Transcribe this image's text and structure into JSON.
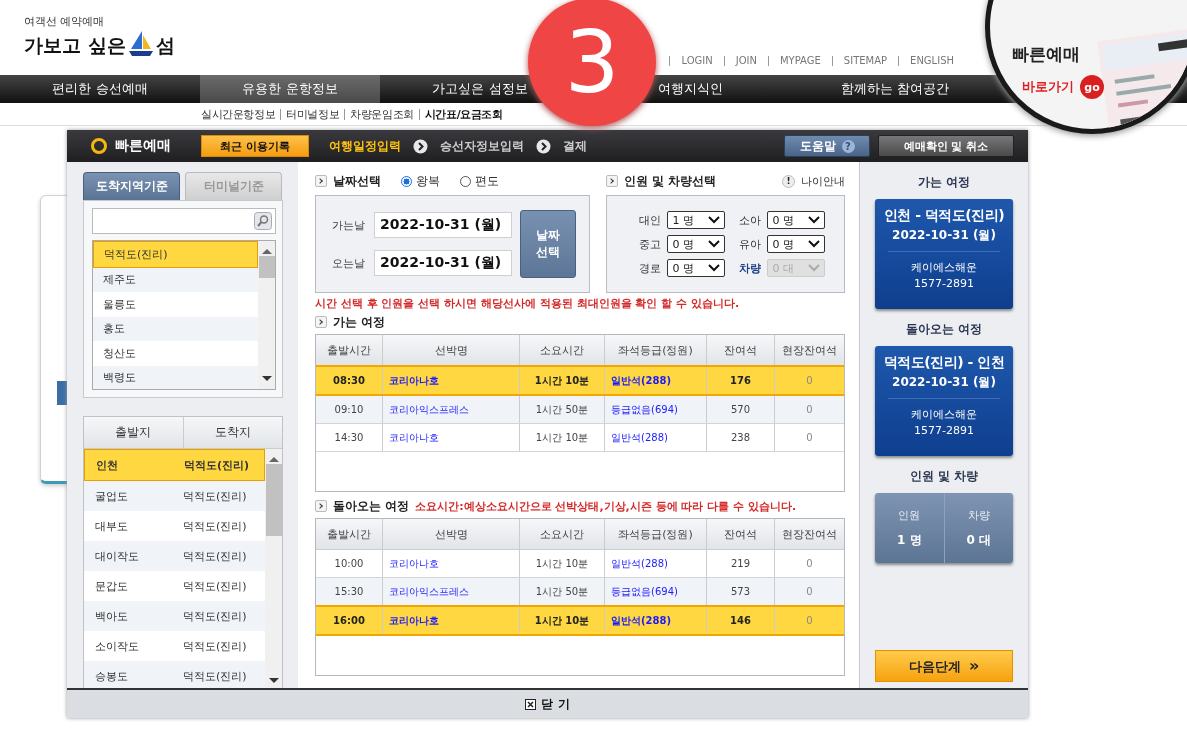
{
  "header": {
    "logo_tagline": "여객선 예약예매",
    "logo_left": "가보고 싶은",
    "logo_right": "섬",
    "top_links": [
      "LOGIN",
      "JOIN",
      "MYPAGE",
      "SITEMAP",
      "ENGLISH"
    ]
  },
  "nav": [
    {
      "label": "편리한 승선예매",
      "selected": false
    },
    {
      "label": "유용한 운항정보",
      "selected": true
    },
    {
      "label": "가고싶은 섬정보",
      "selected": false
    },
    {
      "label": "여행지식인",
      "selected": false
    },
    {
      "label": "함께하는 참여공간",
      "selected": false
    }
  ],
  "subnav": [
    {
      "label": "실시간운항정보",
      "selected": false
    },
    {
      "label": "터미널정보",
      "selected": false
    },
    {
      "label": "차량운임조회",
      "selected": false
    },
    {
      "label": "시간표/요금조회",
      "selected": true
    }
  ],
  "quick_badge": {
    "title": "빠른예매",
    "link": "바로가기",
    "go": "go"
  },
  "step_marker": "3",
  "modal": {
    "title": "빠른예매",
    "recent_button": "최근 이용기록",
    "steps": [
      {
        "label": "여행일정입력",
        "selected": true
      },
      {
        "label": "승선자정보입력",
        "selected": false
      },
      {
        "label": "결제",
        "selected": false
      }
    ],
    "help_button": "도움말",
    "help_icon": "?",
    "confirm_button": "예매확인 및 취소",
    "region_tabs": [
      {
        "label": "도착지역기준",
        "selected": true
      },
      {
        "label": "터미널기준",
        "selected": false
      }
    ],
    "regions": [
      {
        "name": "덕적도(진리)",
        "selected": true
      },
      {
        "name": "제주도",
        "selected": false
      },
      {
        "name": "울릉도",
        "selected": false
      },
      {
        "name": "홍도",
        "selected": false
      },
      {
        "name": "청산도",
        "selected": false
      },
      {
        "name": "백령도",
        "selected": false
      }
    ],
    "route_columns": [
      "출발지",
      "도착지"
    ],
    "routes": [
      {
        "from": "인천",
        "to": "덕적도(진리)",
        "selected": true
      },
      {
        "from": "굴업도",
        "to": "덕적도(진리)",
        "selected": false
      },
      {
        "from": "대부도",
        "to": "덕적도(진리)",
        "selected": false
      },
      {
        "from": "대이작도",
        "to": "덕적도(진리)",
        "selected": false
      },
      {
        "from": "문갑도",
        "to": "덕적도(진리)",
        "selected": false
      },
      {
        "from": "백아도",
        "to": "덕적도(진리)",
        "selected": false
      },
      {
        "from": "소이작도",
        "to": "덕적도(진리)",
        "selected": false
      },
      {
        "from": "승봉도",
        "to": "덕적도(진리)",
        "selected": false
      }
    ],
    "date": {
      "heading": "날짜선택",
      "trip_types": [
        {
          "label": "왕복",
          "selected": true
        },
        {
          "label": "편도",
          "selected": false
        }
      ],
      "fields": [
        {
          "label": "가는날",
          "value": "2022-10-31 (월)"
        },
        {
          "label": "오는날",
          "value": "2022-10-31 (월)"
        }
      ],
      "button_lines": [
        "날짜",
        "선택"
      ]
    },
    "people": {
      "heading": "인원 및 차량선택",
      "age_icon": "!",
      "age_info": "나이안내",
      "selects": [
        {
          "label": "대인",
          "value": "1 명",
          "kind": "person",
          "disabled": false
        },
        {
          "label": "소아",
          "value": "0 명",
          "kind": "person",
          "disabled": false
        },
        {
          "label": "중고",
          "value": "0 명",
          "kind": "person",
          "disabled": false
        },
        {
          "label": "유아",
          "value": "0 명",
          "kind": "person",
          "disabled": false
        },
        {
          "label": "경로",
          "value": "0 명",
          "kind": "person",
          "disabled": false
        },
        {
          "label": "차량",
          "value": "0 대",
          "kind": "vehicle",
          "disabled": true
        }
      ]
    },
    "notice": "시간 선택 후 인원을 선택 하시면 해당선사에 적용된 최대인원을 확인 할 수 있습니다.",
    "outbound": {
      "heading": "가는 여정",
      "columns": [
        "출발시간",
        "선박명",
        "소요시간",
        "좌석등급(정원)",
        "잔여석",
        "현장잔여석"
      ],
      "rows": [
        {
          "time": "08:30",
          "ship": "코리아나호",
          "duration": "1시간 10분",
          "seat": "일반석(288)",
          "remaining": "176",
          "onsite": "0",
          "selected": true
        },
        {
          "time": "09:10",
          "ship": "코리아익스프레스",
          "duration": "1시간 50분",
          "seat": "등급없음(694)",
          "remaining": "570",
          "onsite": "0",
          "selected": false
        },
        {
          "time": "14:30",
          "ship": "코리아나호",
          "duration": "1시간 10분",
          "seat": "일반석(288)",
          "remaining": "238",
          "onsite": "0",
          "selected": false
        }
      ]
    },
    "return": {
      "heading": "돌아오는 여정",
      "note": "소요시간:예상소요시간으로 선박상태,기상,시즌 등에 따라 다를 수 있습니다.",
      "columns": [
        "출발시간",
        "선박명",
        "소요시간",
        "좌석등급(정원)",
        "잔여석",
        "현장잔여석"
      ],
      "rows": [
        {
          "time": "10:00",
          "ship": "코리아나호",
          "duration": "1시간 10분",
          "seat": "일반석(288)",
          "remaining": "219",
          "onsite": "0",
          "selected": false
        },
        {
          "time": "15:30",
          "ship": "코리아익스프레스",
          "duration": "1시간 50분",
          "seat": "등급없음(694)",
          "remaining": "573",
          "onsite": "0",
          "selected": false
        },
        {
          "time": "16:00",
          "ship": "코리아나호",
          "duration": "1시간 10분",
          "seat": "일반석(288)",
          "remaining": "146",
          "onsite": "0",
          "selected": true
        }
      ]
    },
    "summary": {
      "outbound_heading": "가는 여정",
      "outbound": {
        "route": "인천 - 덕적도(진리)",
        "date": "2022-10-31 (월)",
        "company": "케이에스해운",
        "phone": "1577-2891"
      },
      "return_heading": "돌아오는 여정",
      "return": {
        "route": "덕적도(진리) - 인천",
        "date": "2022-10-31 (월)",
        "company": "케이에스해운",
        "phone": "1577-2891"
      },
      "people_heading": "인원 및 차량",
      "people": [
        {
          "label": "인원",
          "value": "1 명"
        },
        {
          "label": "차량",
          "value": "0 대"
        }
      ],
      "next_button": "다음단계",
      "next_icon": "»"
    },
    "close_button": "닫 기"
  }
}
